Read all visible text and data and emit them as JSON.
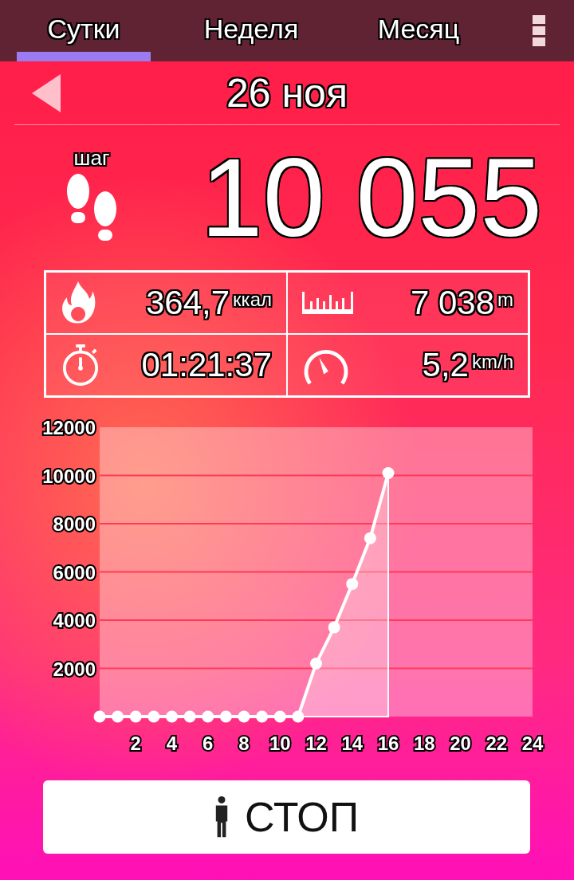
{
  "tabs": [
    {
      "label": "Сутки",
      "selected": true
    },
    {
      "label": "Неделя",
      "selected": false
    },
    {
      "label": "Месяц",
      "selected": false
    }
  ],
  "date": "26 ноя",
  "steps": {
    "label": "шаг",
    "value": "10 055"
  },
  "stats": [
    {
      "kind": "calories",
      "value": "364,7",
      "unit": "ккал"
    },
    {
      "kind": "distance",
      "value": "7 038",
      "unit": "m"
    },
    {
      "kind": "time",
      "value": "01:21:37"
    },
    {
      "kind": "speed",
      "value": "5,2",
      "unit": "km/h"
    }
  ],
  "chart": {
    "chart_data": {
      "type": "line",
      "grid": true,
      "x": [
        0,
        1,
        2,
        3,
        4,
        5,
        6,
        7,
        8,
        9,
        10,
        11,
        12,
        13,
        14,
        15,
        16
      ],
      "series": [
        {
          "color": "#ffffff",
          "marker": "circle",
          "values": [
            0,
            0,
            0,
            0,
            0,
            0,
            0,
            0,
            0,
            0,
            0,
            0,
            2200,
            3700,
            5500,
            7400,
            10100
          ]
        }
      ],
      "xlim": [
        0,
        24
      ],
      "ylim": [
        0,
        12000
      ],
      "xticks": [
        2,
        4,
        6,
        8,
        10,
        12,
        14,
        16,
        18,
        20,
        22,
        24
      ],
      "yticks": [
        2000,
        4000,
        6000,
        8000,
        10000,
        12000
      ]
    }
  },
  "button": {
    "label": "СТОП"
  }
}
